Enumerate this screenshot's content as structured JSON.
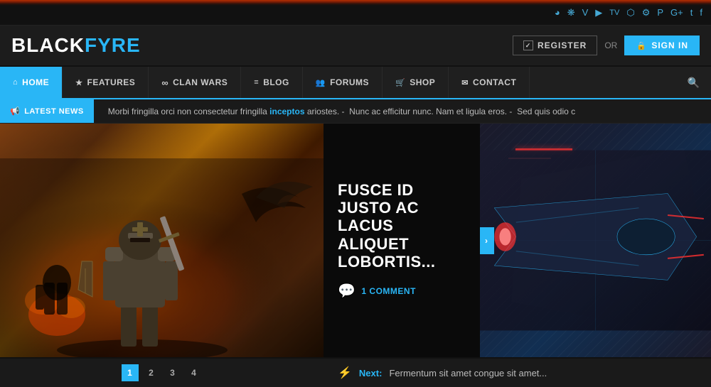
{
  "site": {
    "logo_black": "BLACK",
    "logo_fyre": "FYRE"
  },
  "social_bar": {
    "icons": [
      "rss",
      "dribbble",
      "vine",
      "youtube",
      "twitch",
      "instagram",
      "steam",
      "pinterest",
      "google-plus",
      "twitter",
      "facebook"
    ]
  },
  "header": {
    "register_label": "REGISTER",
    "or_label": "OR",
    "signin_label": "SIGN IN"
  },
  "nav": {
    "items": [
      {
        "id": "home",
        "label": "HOME",
        "icon": "⌂",
        "active": true
      },
      {
        "id": "features",
        "label": "FEATURES",
        "icon": "★",
        "active": false
      },
      {
        "id": "clan-wars",
        "label": "CLAN WARS",
        "icon": "∞",
        "active": false
      },
      {
        "id": "blog",
        "label": "BLOG",
        "icon": "📶",
        "active": false
      },
      {
        "id": "forums",
        "label": "FORUMS",
        "icon": "👥",
        "active": false
      },
      {
        "id": "shop",
        "label": "SHOP",
        "icon": "🛒",
        "active": false
      },
      {
        "id": "contact",
        "label": "CONTACT",
        "icon": "✉",
        "active": false
      }
    ],
    "search_icon": "🔍"
  },
  "ticker": {
    "label": "LATEST NEWS",
    "label_icon": "📢",
    "text_parts": [
      {
        "text": "Morbi fringilla orci non consectetur fringilla ",
        "type": "normal"
      },
      {
        "text": "inceptos",
        "type": "link"
      },
      {
        "text": " ariostes. -  Nunc ac efficitur nunc. Nam et ligula eros. -  Sed quis odio c",
        "type": "normal"
      }
    ]
  },
  "featured": {
    "title": "FUSCE ID JUSTO AC LACUS ALIQUET LOBORTIS...",
    "comment_count": "1 COMMENT",
    "comment_icon": "💬"
  },
  "pagination": {
    "pages": [
      "1",
      "2",
      "3",
      "4"
    ],
    "active": "1"
  },
  "next_bar": {
    "icon": "⚡",
    "label": "Next:",
    "text": "Fermentum sit amet congue sit amet..."
  }
}
